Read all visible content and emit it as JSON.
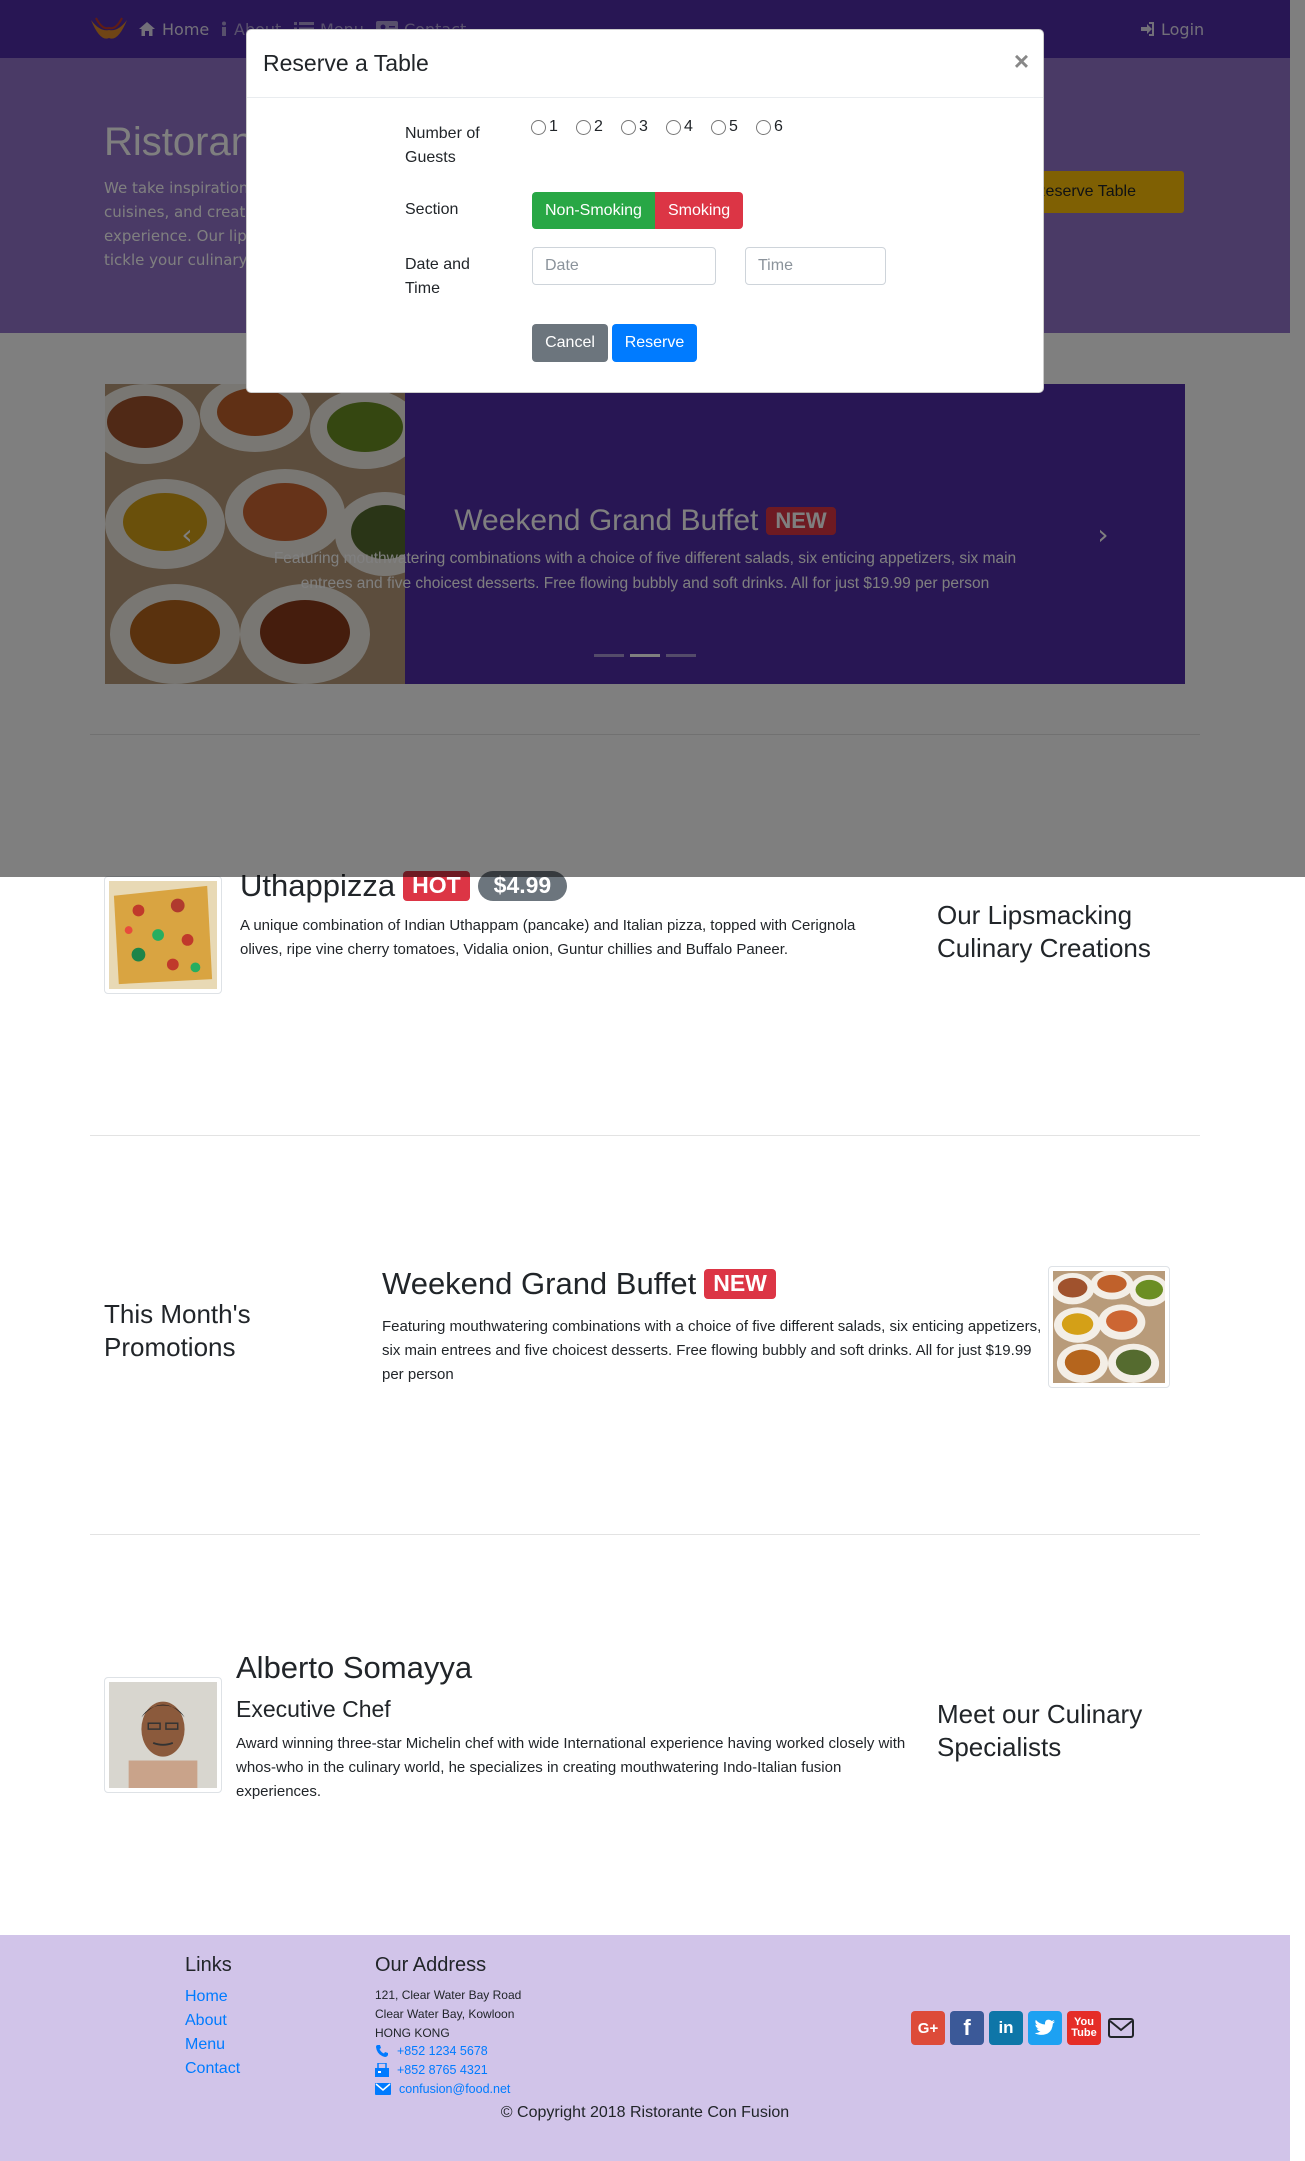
{
  "navbar": {
    "links": [
      {
        "label": "Home",
        "icon": "home-icon"
      },
      {
        "label": "About",
        "icon": "info-icon"
      },
      {
        "label": "Menu",
        "icon": "list-icon"
      },
      {
        "label": "Contact",
        "icon": "address-card-icon"
      }
    ],
    "login_label": "Login"
  },
  "jumbotron": {
    "title": "Ristorante Con Fusion",
    "text": "We take inspiration from the World's best cuisines, and create a unique fusion experience. Our lipsmacking creations will tickle your culinary senses!",
    "reserve_label": "Reserve Table"
  },
  "carousel": {
    "title": "Weekend Grand Buffet",
    "badge": "NEW",
    "description": "Featuring mouthwatering combinations with a choice of five different salads, six enticing appetizers, six main entrees and five choicest desserts. Free flowing bubbly and soft drinks. All for just $19.99 per person",
    "prev_icon": "chevron-left-icon",
    "next_icon": "chevron-right-icon",
    "indicators": 3,
    "active_indicator": 1
  },
  "dish": {
    "heading": "Our Lipsmacking Culinary Creations",
    "name": "Uthappizza",
    "badge": "HOT",
    "price": "$4.99",
    "description": "A unique combination of Indian Uthappam (pancake) and Italian pizza, topped with Cerignola olives, ripe vine cherry tomatoes, Vidalia onion, Guntur chillies and Buffalo Paneer."
  },
  "promotion": {
    "heading": "This Month's Promotions",
    "name": "Weekend Grand Buffet",
    "badge": "NEW",
    "description": "Featuring mouthwatering combinations with a choice of five different salads, six enticing appetizers, six main entrees and five choicest desserts. Free flowing bubbly and soft drinks. All for just $19.99 per person"
  },
  "chef": {
    "heading": "Meet our Culinary Specialists",
    "name": "Alberto Somayya",
    "title": "Executive Chef",
    "description": "Award winning three-star Michelin chef with wide International experience having worked closely with whos-who in the culinary world, he specializes in creating mouthwatering Indo-Italian fusion experiences."
  },
  "footer": {
    "links_heading": "Links",
    "links": [
      "Home",
      "About",
      "Menu",
      "Contact"
    ],
    "address_heading": "Our Address",
    "address": [
      "121, Clear Water Bay Road",
      "Clear Water Bay, Kowloon",
      "HONG KONG"
    ],
    "phone": "+852 1234 5678",
    "fax": "+852 8765 4321",
    "email": "confusion@food.net",
    "social": [
      "google-plus-icon",
      "facebook-icon",
      "linkedin-icon",
      "twitter-icon",
      "youtube-icon",
      "envelope-icon"
    ],
    "copyright": "© Copyright 2018 Ristorante Con Fusion"
  },
  "modal": {
    "title": "Reserve a Table",
    "close": "×",
    "guests_label": "Number of Guests",
    "guest_options": [
      "1",
      "2",
      "3",
      "4",
      "5",
      "6"
    ],
    "section_label": "Section",
    "section_options": [
      "Non-Smoking",
      "Smoking"
    ],
    "datetime_label": "Date and Time",
    "date_placeholder": "Date",
    "time_placeholder": "Time",
    "cancel_label": "Cancel",
    "reserve_label": "Reserve"
  },
  "colors": {
    "primary_dark": "#512DA8",
    "primary": "#9575CD",
    "footer": "#D1C4E9",
    "warning": "#FFC107",
    "danger": "#dc3545",
    "success": "#28a745",
    "link": "#007bff"
  }
}
